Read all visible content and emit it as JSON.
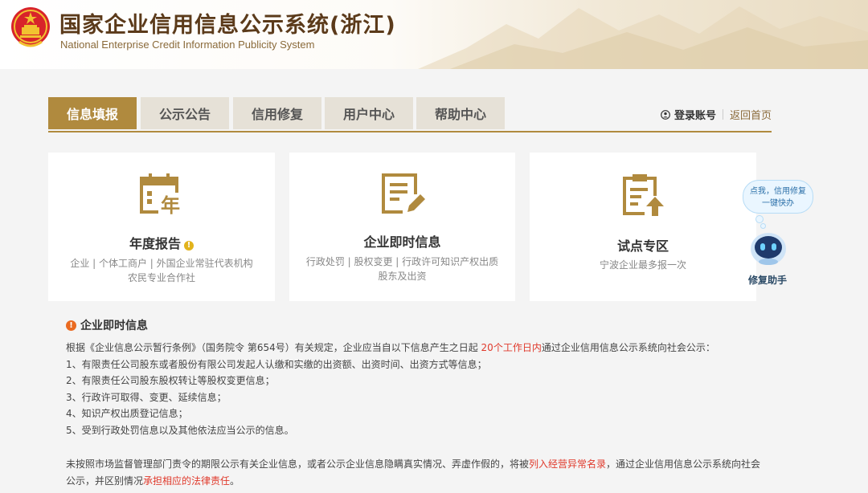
{
  "header": {
    "title": "国家企业信用信息公示系统(浙江)",
    "subtitle": "National Enterprise Credit Information Publicity System"
  },
  "nav": {
    "tabs": [
      {
        "label": "信息填报",
        "active": true
      },
      {
        "label": "公示公告",
        "active": false
      },
      {
        "label": "信用修复",
        "active": false
      },
      {
        "label": "用户中心",
        "active": false
      },
      {
        "label": "帮助中心",
        "active": false
      }
    ],
    "login_label": "登录账号",
    "home_label": "返回首页"
  },
  "cards": [
    {
      "title": "年度报告",
      "desc_line1": "企业 | 个体工商户 | 外国企业常驻代表机构",
      "desc_line2": "农民专业合作社",
      "icon": "calendar-year-icon"
    },
    {
      "title": "企业即时信息",
      "desc_line1": "行政处罚 | 股权变更 | 行政许可知识产权出质",
      "desc_line2": "股东及出资",
      "icon": "document-edit-icon"
    },
    {
      "title": "试点专区",
      "desc_line1": "宁波企业最多报一次",
      "desc_line2": "",
      "icon": "clipboard-upload-icon"
    }
  ],
  "assistant": {
    "bubble_line1": "点我，信用修复",
    "bubble_line2": "一键快办",
    "label": "修复助手"
  },
  "notice": {
    "title": "企业即时信息",
    "intro_before": "根据《企业信息公示暂行条例》（国务院令 第654号）有关规定，企业应当自以下信息产生之日起 ",
    "intro_highlight": "20个工作日内",
    "intro_after": "通过企业信用信息公示系统向社会公示：",
    "items": [
      "1、有限责任公司股东或者股份有限公司发起人认缴和实缴的出资额、出资时间、出资方式等信息；",
      "2、有限责任公司股东股权转让等股权变更信息；",
      "3、行政许可取得、变更、延续信息；",
      "4、知识产权出质登记信息；",
      "5、受到行政处罚信息以及其他依法应当公示的信息。"
    ],
    "footer_part1": "未按照市场监督管理部门责令的期限公示有关企业信息，或者公示企业信息隐瞒真实情况、弄虚作假的，将被",
    "footer_highlight1": "列入经营异常名录",
    "footer_part2": "，通过企业信用信息公示系统向社会公示，并区别情况",
    "footer_highlight2": "承担相应的法律责任",
    "footer_part3": "。"
  },
  "colors": {
    "accent": "#b08a3e",
    "highlight_red": "#e03a2c",
    "title_brown": "#5b3a1a"
  }
}
